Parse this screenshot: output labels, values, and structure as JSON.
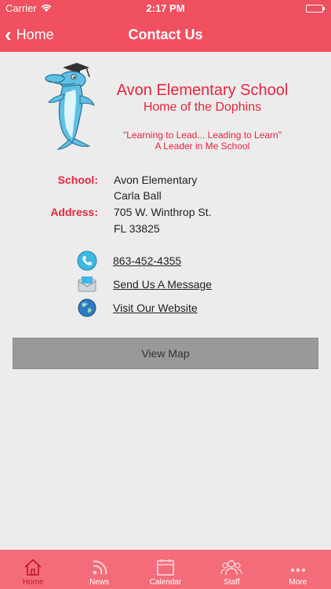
{
  "status_bar": {
    "carrier": "Carrier",
    "time": "2:17 PM"
  },
  "nav": {
    "back_label": "Home",
    "title": "Contact Us"
  },
  "header": {
    "school_name": "Avon Elementary School",
    "subtitle": "Home of the Dophins",
    "motto_line1": "\"Learning to Lead... Leading to Learn\"",
    "motto_line2": "A Leader in Me School"
  },
  "info": {
    "school_label": "School:",
    "school_name": "Avon Elementary",
    "contact_name": "Carla Ball",
    "address_label": "Address:",
    "address_line1": "705 W. Winthrop St.",
    "address_line2": "FL 33825"
  },
  "contacts": {
    "phone": "863-452-4355",
    "message": "Send Us A Message",
    "website": "Visit Our Website"
  },
  "map_button": "View Map",
  "tabs": [
    {
      "label": "Home",
      "icon": "home-icon"
    },
    {
      "label": "News",
      "icon": "rss-icon"
    },
    {
      "label": "Calendar",
      "icon": "calendar-icon"
    },
    {
      "label": "Staff",
      "icon": "staff-icon"
    },
    {
      "label": "More",
      "icon": "more-icon"
    }
  ],
  "colors": {
    "brand": "#f0505f",
    "accent_text": "#e8253c",
    "tab_active": "#c4122a"
  }
}
